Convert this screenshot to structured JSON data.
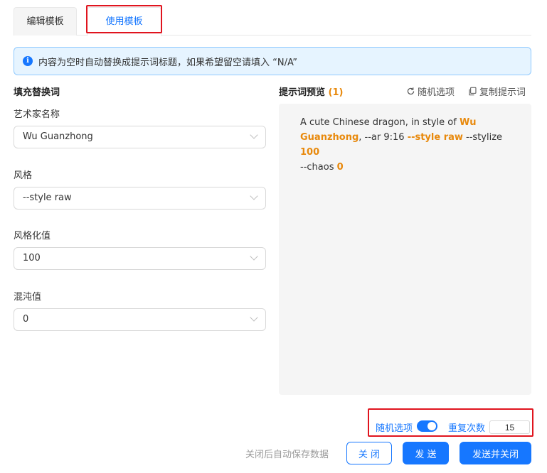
{
  "tabs": [
    {
      "label": "编辑模板",
      "active": false
    },
    {
      "label": "使用模板",
      "active": true
    }
  ],
  "info": {
    "text": "内容为空时自动替换成提示词标题，如果希望留空请填入 “N/A”"
  },
  "fill_section": {
    "title": "填充替换词",
    "fields": [
      {
        "label": "艺术家名称",
        "value": "Wu Guanzhong"
      },
      {
        "label": "风格",
        "value": "--style raw"
      },
      {
        "label": "风格化值",
        "value": "100"
      },
      {
        "label": "混沌值",
        "value": "0"
      }
    ]
  },
  "preview": {
    "title": "提示词预览",
    "count": "(1)",
    "random_label": "随机选项",
    "copy_label": "复制提示词",
    "segments": [
      {
        "text": "A cute Chinese dragon, in style of ",
        "highlight": false
      },
      {
        "text": "Wu Guanzhong",
        "highlight": true
      },
      {
        "text": ", --ar 9:16 ",
        "highlight": false
      },
      {
        "text": "--style raw",
        "highlight": true
      },
      {
        "text": " --stylize ",
        "highlight": false
      },
      {
        "text": "100",
        "highlight": true
      },
      {
        "text": " --chaos ",
        "highlight": false
      },
      {
        "text": "0",
        "highlight": true
      }
    ]
  },
  "bottom": {
    "random_toggle_label": "随机选项",
    "random_toggle_on": true,
    "repeat_label": "重复次数",
    "repeat_value": "15",
    "autosave_text": "关闭后自动保存数据",
    "close_label": "关 闭",
    "send_label": "发 送",
    "send_close_label": "发送并关闭"
  },
  "colors": {
    "accent": "#1677ff",
    "highlight": "#e8890c",
    "annotation": "#e0141e"
  }
}
